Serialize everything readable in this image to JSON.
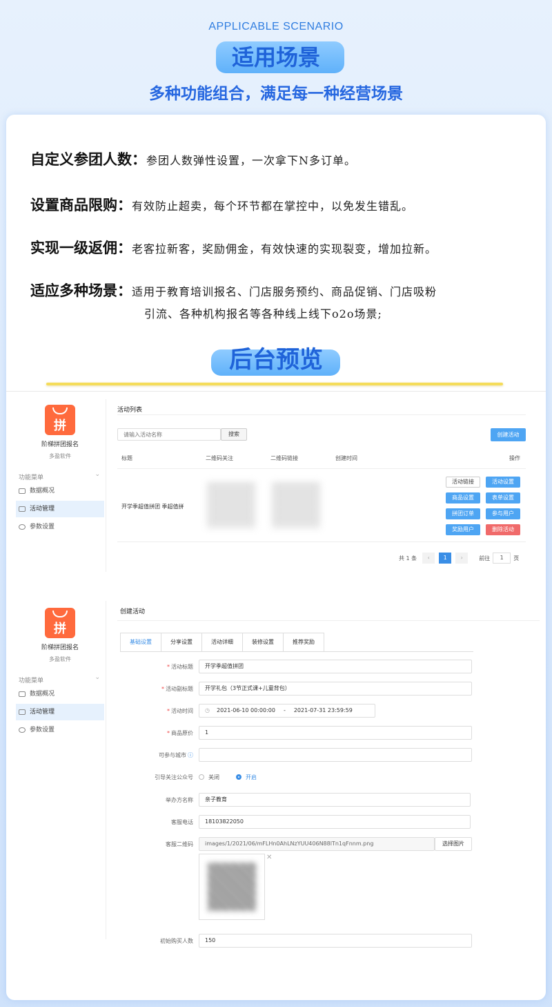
{
  "header": {
    "en_title": "APPLICABLE SCENARIO",
    "cn_title": "适用场景",
    "subtitle": "多种功能组合，满足每一种经营场景"
  },
  "features": [
    {
      "title": "自定义参团人数：",
      "desc": "参团人数弹性设置，一次拿下N多订单。"
    },
    {
      "title": "设置商品限购：",
      "desc": "有效防止超卖，每个环节都在掌控中，以免发生错乱。"
    },
    {
      "title": "实现一级返佣：",
      "desc": "老客拉新客，奖励佣金，有效快速的实现裂变，增加拉新。"
    },
    {
      "title": "适应多种场景：",
      "desc": "适用于教育培训报名、门店服务预约、商品促销、门店吸粉",
      "desc2": "引流、各种机构报名等各种线上线下o2o场景;"
    }
  ],
  "preview_title": "后台预览",
  "sidebar": {
    "app_logo_char": "拼",
    "app_name": "阶梯拼团报名",
    "app_sub": "多盈软件",
    "menu_header": "功能菜单",
    "items": [
      "数据概况",
      "活动管理",
      "参数设置"
    ]
  },
  "list_screen": {
    "title": "活动列表",
    "search_placeholder": "请输入活动名称",
    "search_button": "搜索",
    "create_button": "创建活动",
    "columns": [
      "标题",
      "二维码关注",
      "二维码链接",
      "创建时间",
      "操作"
    ],
    "row": {
      "title": "开学季超值拼团 季超值拼",
      "actions": [
        "活动链接",
        "活动设置",
        "商品设置",
        "表单设置",
        "拼团订单",
        "参与用户",
        "奖励用户",
        "删除活动"
      ]
    },
    "pager": {
      "total": "共 1 条",
      "current": "1",
      "goto_label": "前往",
      "goto_value": "1",
      "page_suffix": "页"
    }
  },
  "form_screen": {
    "title": "创建活动",
    "tabs": [
      "基础设置",
      "分享设置",
      "活动详细",
      "装修设置",
      "推荐奖励"
    ],
    "fields": {
      "activity_title": {
        "label": "活动标题",
        "value": "开学季超值拼团"
      },
      "activity_subtitle": {
        "label": "活动副标题",
        "value": "开学礼包（3节正式课+儿童背包）"
      },
      "activity_time": {
        "label": "活动时间",
        "start": "2021-06-10 00:00:00",
        "sep": "-",
        "end": "2021-07-31 23:59:59"
      },
      "original_price": {
        "label": "商品原价",
        "value": "1"
      },
      "cities": {
        "label": "可参与城市"
      },
      "follow": {
        "label": "引导关注公众号",
        "off": "关闭",
        "on": "开启"
      },
      "organizer": {
        "label": "举办方名称",
        "value": "亲子教育"
      },
      "phone": {
        "label": "客服电话",
        "value": "18103822050"
      },
      "qrcode": {
        "label": "客服二维码",
        "value": "images/1/2021/06/mFLHn0AhLNzYUU406N88lTn1qFnnm.png",
        "button": "选择图片"
      },
      "initial_buyers": {
        "label": "初始购买人数",
        "value": "150"
      }
    }
  },
  "colors": {
    "accent": "#2f7de0",
    "brand_orange": "#ff6a3d",
    "button_blue": "#4ea5f3",
    "danger": "#f06a6a"
  }
}
